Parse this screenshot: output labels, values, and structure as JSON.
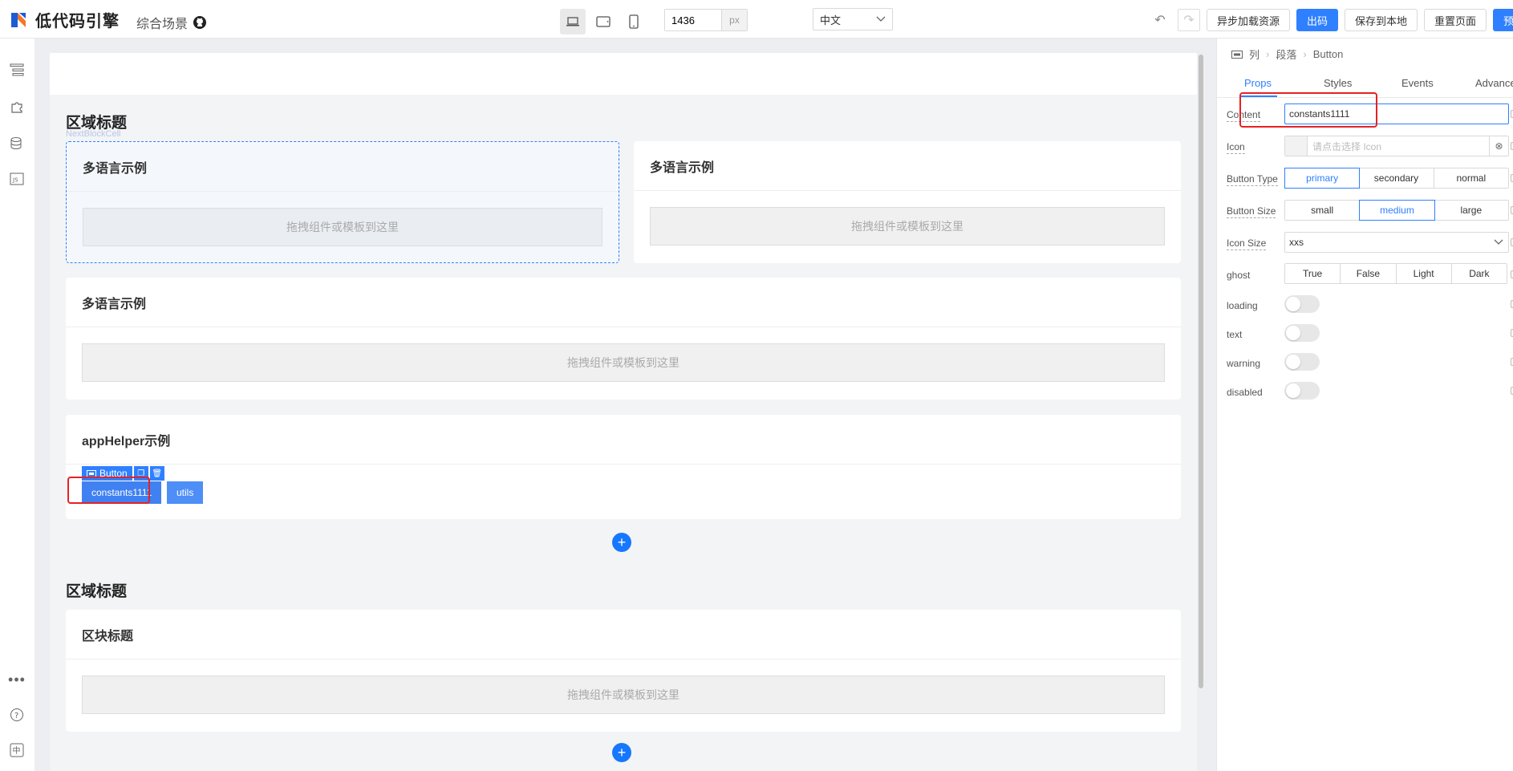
{
  "header": {
    "logo_text": "低代码引擎",
    "scene": "综合场景",
    "width_value": "1436",
    "width_unit": "px",
    "language": "中文",
    "buttons": {
      "async_load": "异步加载资源",
      "code": "出码",
      "save_local": "保存到本地",
      "reset_page": "重置页面",
      "preview": "预览"
    }
  },
  "canvas": {
    "sections": [
      {
        "title": "区域标题"
      },
      {
        "title": "区域标题"
      }
    ],
    "hover_label": "NextBlockCell",
    "cards": {
      "card1": "多语言示例",
      "card2": "多语言示例",
      "card3": "多语言示例",
      "card4": "appHelper示例",
      "card5": "区块标题"
    },
    "drop_placeholder": "拖拽组件或模板到这里",
    "selected_component": "Button",
    "demo_buttons": {
      "constants": "constants1111",
      "utils": "utils"
    }
  },
  "panel": {
    "breadcrumb": [
      "列",
      "段落",
      "Button"
    ],
    "tabs": [
      "Props",
      "Styles",
      "Events",
      "Advance"
    ],
    "props": {
      "content_label": "Content",
      "content_value": "constants1111",
      "icon_label": "Icon",
      "icon_placeholder": "请点击选择 Icon",
      "button_type_label": "Button Type",
      "button_type_options": [
        "primary",
        "secondary",
        "normal"
      ],
      "button_size_label": "Button Size",
      "button_size_options": [
        "small",
        "medium",
        "large"
      ],
      "icon_size_label": "Icon Size",
      "icon_size_value": "xxs",
      "ghost_label": "ghost",
      "ghost_options": [
        "True",
        "False",
        "Light",
        "Dark"
      ],
      "loading_label": "loading",
      "text_label": "text",
      "warning_label": "warning",
      "disabled_label": "disabled"
    }
  },
  "colors": {
    "accent": "#2f80ff",
    "highlight": "#e52222"
  }
}
